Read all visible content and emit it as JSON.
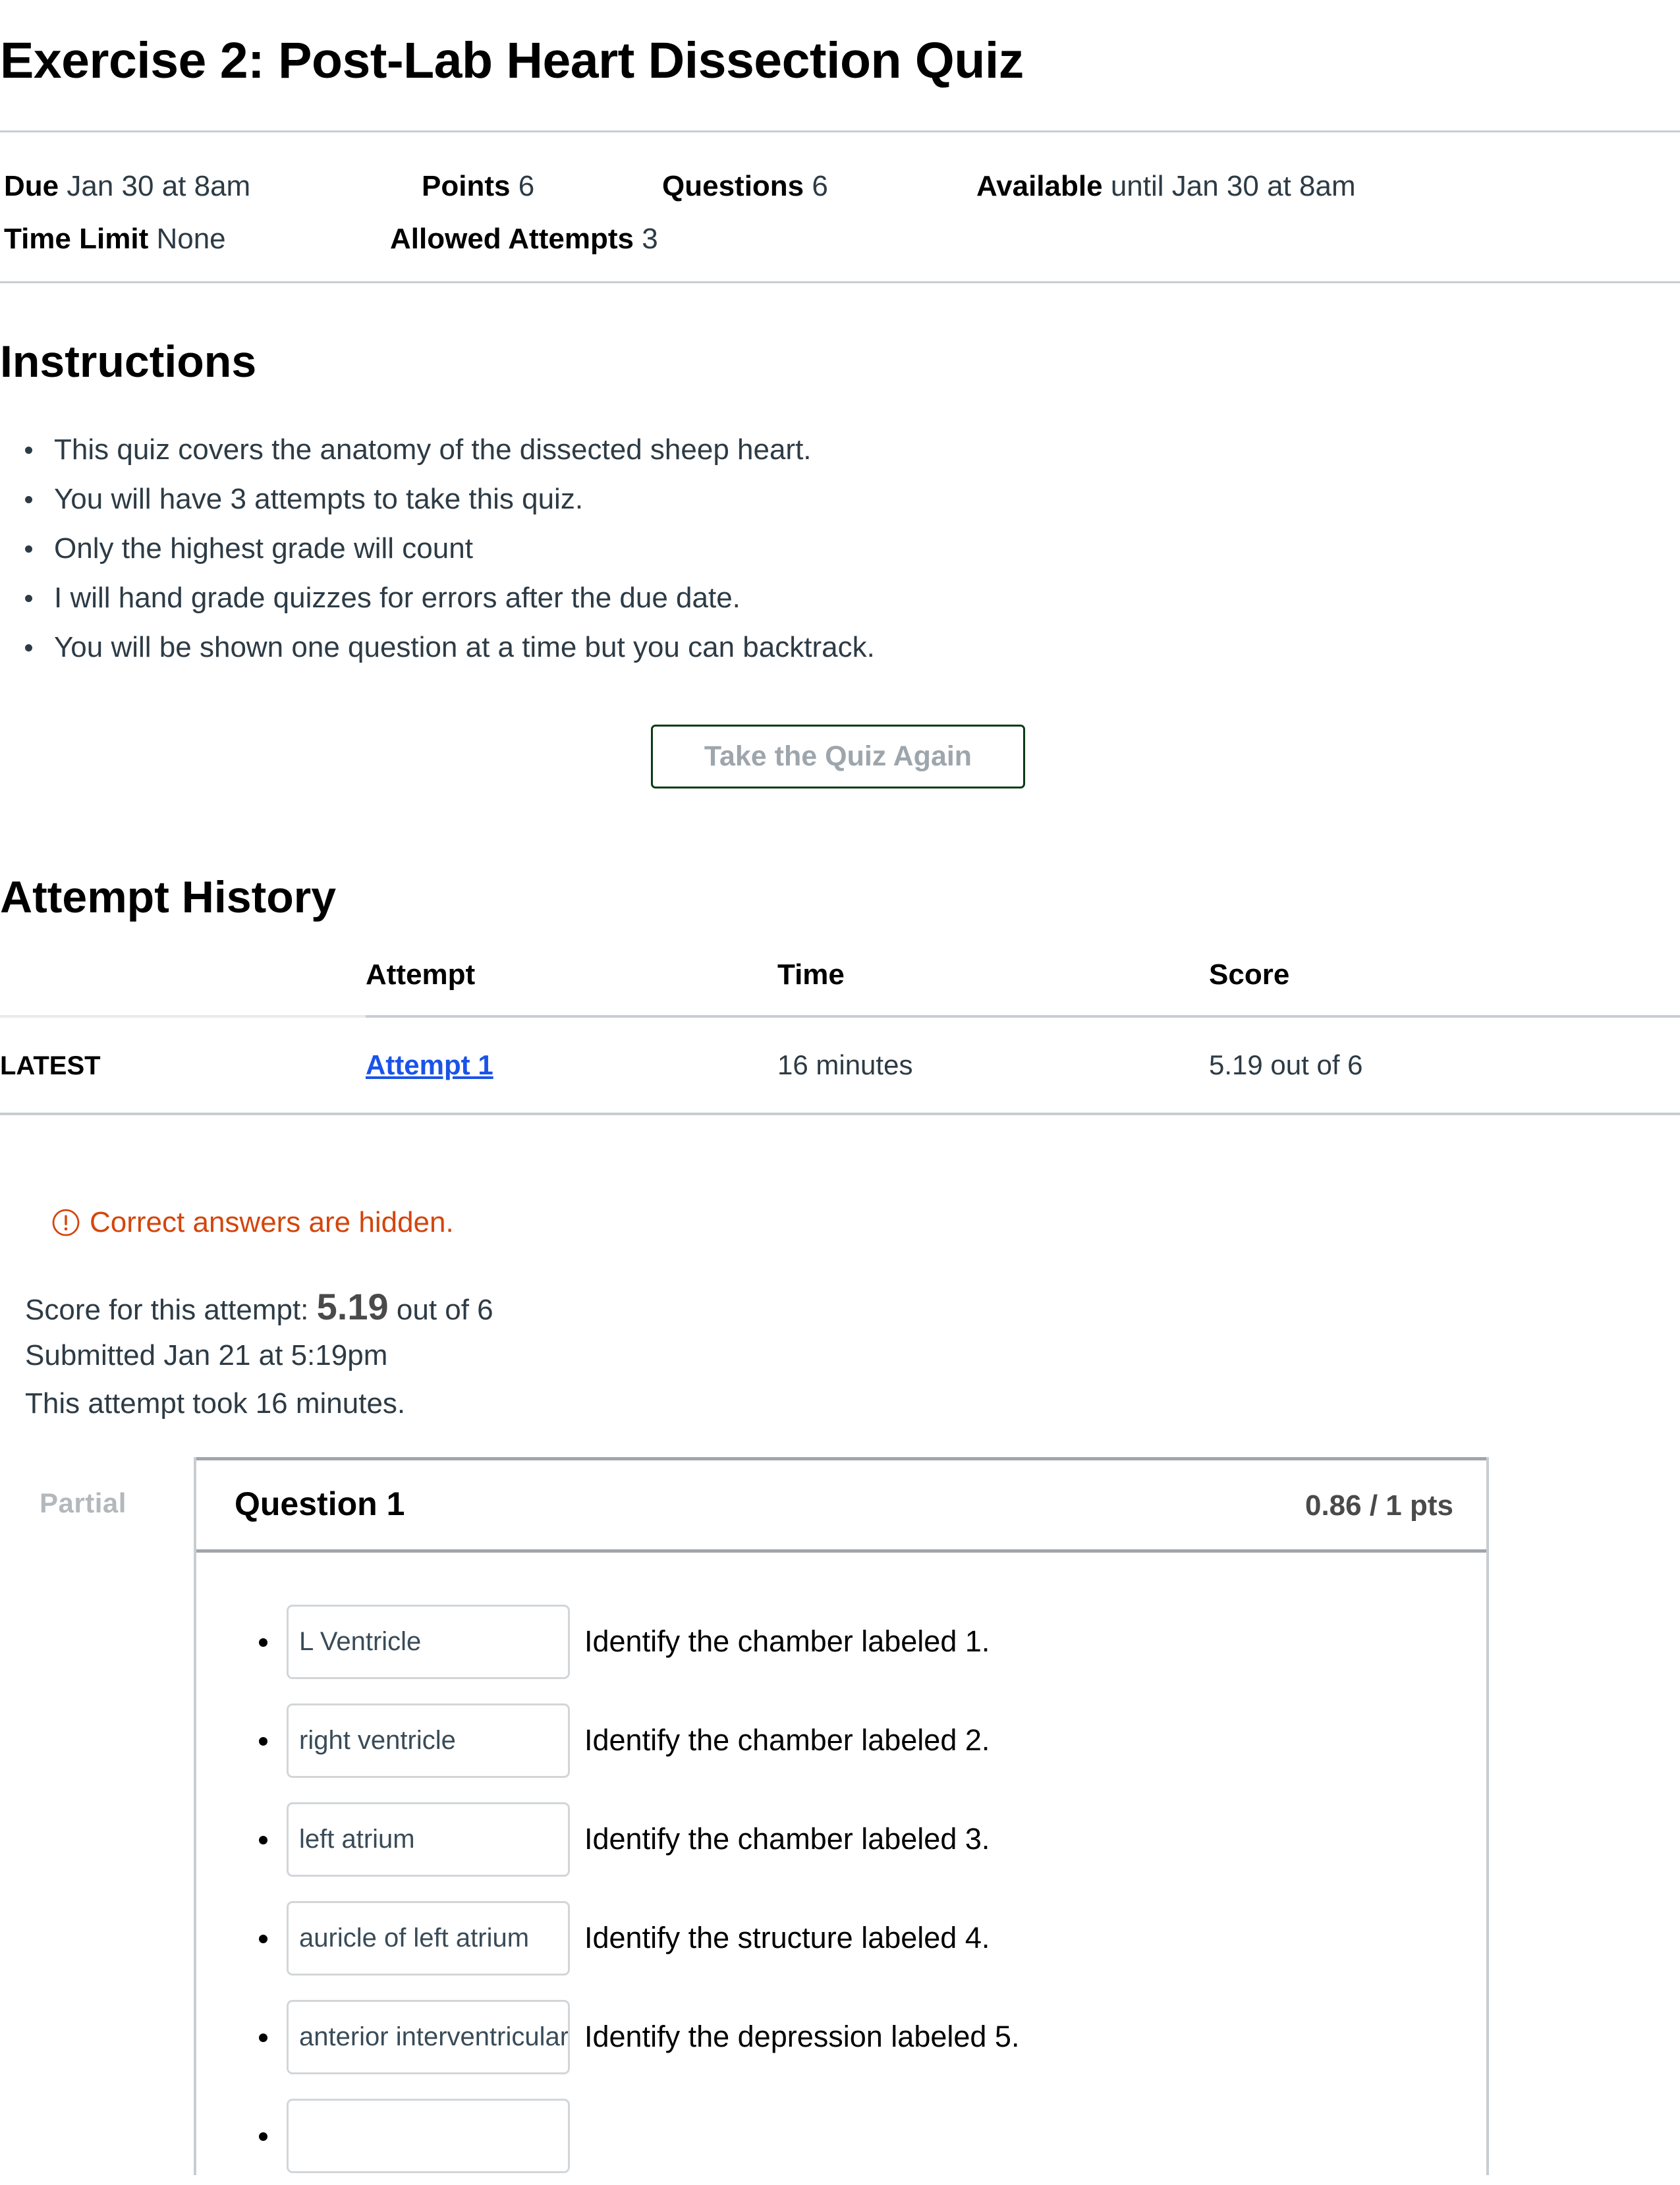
{
  "header": {
    "title": "Exercise 2: Post-Lab Heart Dissection Quiz",
    "meta_row_1": [
      {
        "label": "Due",
        "value": "Jan 30 at 8am"
      },
      {
        "label": "Points",
        "value": "6"
      },
      {
        "label": "Questions",
        "value": "6"
      },
      {
        "label": "Available",
        "value": "until Jan 30 at 8am"
      }
    ],
    "meta_row_2": [
      {
        "label": "Time Limit",
        "value": "None"
      },
      {
        "label": "Allowed Attempts",
        "value": "3"
      }
    ]
  },
  "instructions": {
    "heading": "Instructions",
    "items": [
      "This quiz covers the anatomy of the dissected sheep heart.",
      "You will have 3 attempts to take this quiz.",
      "Only the highest grade will count",
      "I will hand grade quizzes for errors after the due date.",
      "You will be shown one question at a time but you can backtrack."
    ]
  },
  "actions": {
    "take_quiz_again": "Take the Quiz Again"
  },
  "attempt_history": {
    "heading": "Attempt History",
    "columns": [
      "",
      "Attempt",
      "Time",
      "Score"
    ],
    "rows": [
      {
        "flag": "LATEST",
        "attempt": "Attempt 1",
        "time": "16 minutes",
        "score": "5.19 out of 6"
      }
    ]
  },
  "notice": {
    "icon": "warning-circle-icon",
    "text": "Correct answers are hidden.",
    "color": "#d4450c"
  },
  "attempt_summary": {
    "score_prefix": "Score for this attempt:",
    "score_value": "5.19",
    "score_suffix": "out of 6",
    "submitted": "Submitted Jan 21 at 5:19pm",
    "duration": "This attempt took 16 minutes."
  },
  "question": {
    "status": "Partial",
    "title": "Question 1",
    "points": "0.86 / 1 pts",
    "answers": [
      {
        "value": "L Ventricle",
        "prompt": "Identify the chamber labeled 1."
      },
      {
        "value": "right ventricle",
        "prompt": "Identify the chamber labeled 2."
      },
      {
        "value": "left atrium",
        "prompt": "Identify the chamber labeled 3."
      },
      {
        "value": "auricle of left atrium",
        "prompt": "Identify the structure labeled 4."
      },
      {
        "value": "anterior interventricular sulcus",
        "prompt": "Identify the depression labeled 5."
      },
      {
        "value": "",
        "prompt": ""
      }
    ]
  }
}
